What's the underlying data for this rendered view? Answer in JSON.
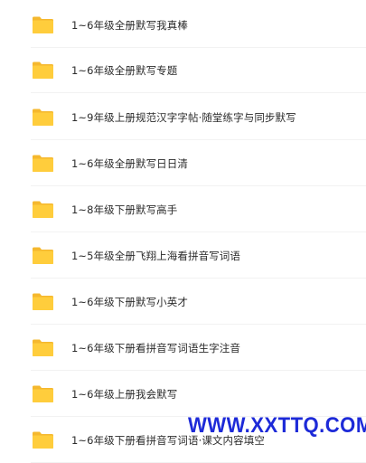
{
  "icons": {
    "folder": "folder-icon"
  },
  "colors": {
    "folder": "#ffcd3c",
    "watermark": "#1d2ad8"
  },
  "folders": [
    {
      "name": "1~6年级全册默写我真棒"
    },
    {
      "name": "1~6年级全册默写专题"
    },
    {
      "name": "1~9年级上册规范汉字字帖·随堂练字与同步默写"
    },
    {
      "name": "1~6年级全册默写日日清"
    },
    {
      "name": "1~8年级下册默写高手"
    },
    {
      "name": "1~5年级全册飞翔上海看拼音写词语"
    },
    {
      "name": "1~6年级下册默写小英才"
    },
    {
      "name": "1~6年级下册看拼音写词语生字注音"
    },
    {
      "name": "1~6年级上册我会默写"
    },
    {
      "name": "1~6年级下册看拼音写词语·课文内容填空"
    }
  ],
  "watermark": {
    "text": "WWW.XXTTQ.COM"
  }
}
